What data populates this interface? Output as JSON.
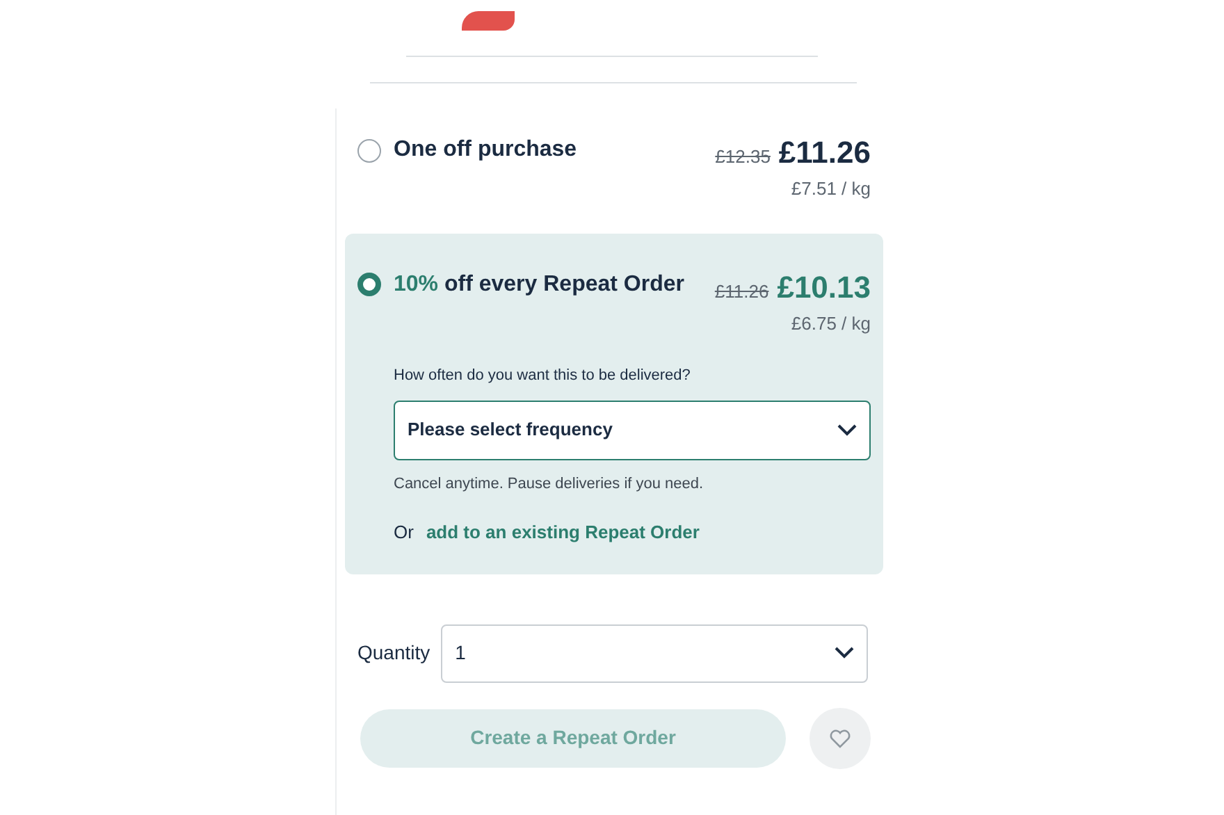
{
  "options": [
    {
      "kind": "one_off",
      "selected": false,
      "label": "One off purchase",
      "old_price": "£12.35",
      "price": "£11.26",
      "unit_price": "£7.51 / kg"
    },
    {
      "kind": "repeat",
      "selected": true,
      "discount": "10%",
      "label": "off every Repeat Order",
      "old_price": "£11.26",
      "price": "£10.13",
      "unit_price": "£6.75 / kg",
      "frequency_question": "How often do you want this to be delivered?",
      "frequency_placeholder": "Please select frequency",
      "note": "Cancel anytime. Pause deliveries if you need.",
      "or_text": "Or",
      "existing_link": "add to an existing Repeat Order"
    }
  ],
  "quantity": {
    "label": "Quantity",
    "value": "1"
  },
  "submit": {
    "label": "Create a Repeat Order",
    "disabled": true
  }
}
